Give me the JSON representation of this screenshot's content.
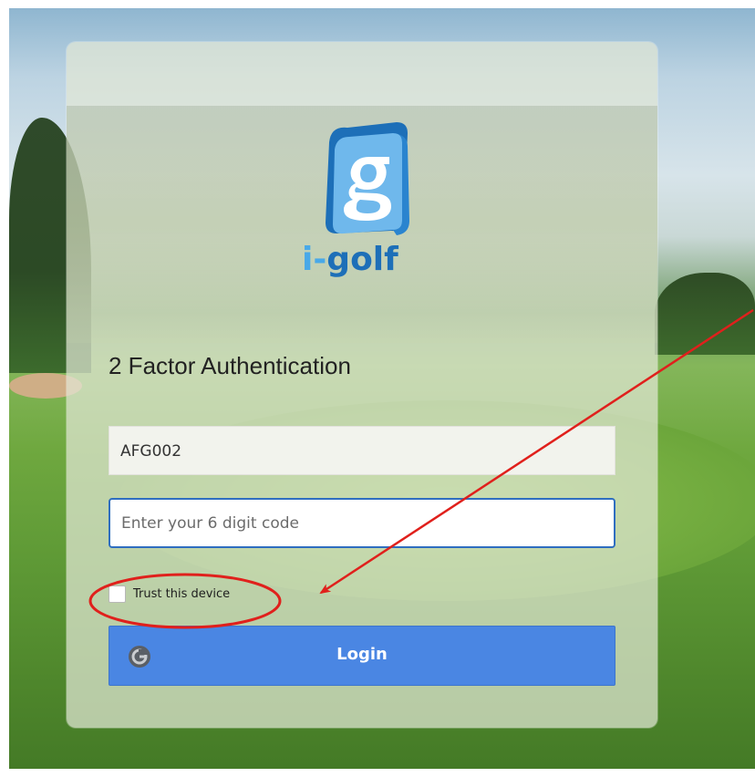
{
  "brand": {
    "name_prefix": "i",
    "name_dash": "-",
    "name_suffix": "golf",
    "primary_color": "#1d6fb8",
    "accent_color": "#49a9e8"
  },
  "form": {
    "title": "2 Factor Authentication",
    "username_value": "AFG002",
    "code_placeholder": "Enter your 6 digit code",
    "trust_label": "Trust this device",
    "trust_checked": false,
    "login_label": "Login"
  },
  "colors": {
    "login_button": "#4a86e3",
    "annotation": "#e0201c"
  },
  "icons": {
    "logo": "i-golf-logo",
    "login": "g-power-icon"
  }
}
